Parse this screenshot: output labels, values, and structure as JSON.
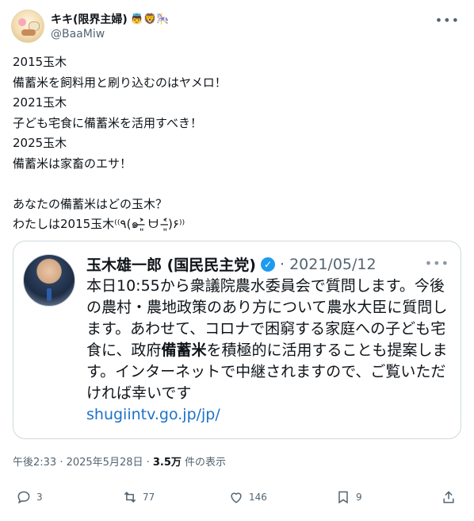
{
  "author": {
    "display_name": "キキ(限界主婦)",
    "emojis": "👼🦁🎠",
    "handle": "@BaaMiw"
  },
  "tweet": {
    "text": "2015玉木\n備蓄米を飼料用と刷り込むのはヤメロ！\n2021玉木\n子ども宅食に備蓄米を活用すべき！\n2025玉木\n備蓄米は家畜のエサ！\n\nあなたの備蓄米はどの玉木？\nわたしは2015玉木⁽⁽٩(๑˃̶͈̀ ᗨ ˂̶͈́)۶⁾⁾"
  },
  "quote": {
    "display_name": "玉木雄一郎 (国民民主党)",
    "date": "· 2021/05/12",
    "body_before": "本日10:55から衆議院農水委員会で質問します。今後の農村・農地政策のあり方について農水大臣に質問します。あわせて、コロナで困窮する家庭への子ども宅食に、政府",
    "body_bold": "備蓄米",
    "body_after": "を積極的に活用することも提案します。インターネットで中継されますので、ご覧いただければ幸いです",
    "link": "shugiintv.go.jp/jp/"
  },
  "meta": {
    "time": "午後2:33 · 2025年5月28日 · ",
    "views": "3.5万",
    "views_label": " 件の表示"
  },
  "actions": {
    "replies": "3",
    "retweets": "77",
    "likes": "146",
    "bookmarks": "9"
  },
  "icons": [
    "more-icon",
    "verified-badge-icon",
    "reply-icon",
    "retweet-icon",
    "like-icon",
    "bookmark-icon",
    "share-icon"
  ],
  "colors": {
    "accent": "#1d9bf0",
    "link": "#1d72c8",
    "muted": "#536471"
  }
}
